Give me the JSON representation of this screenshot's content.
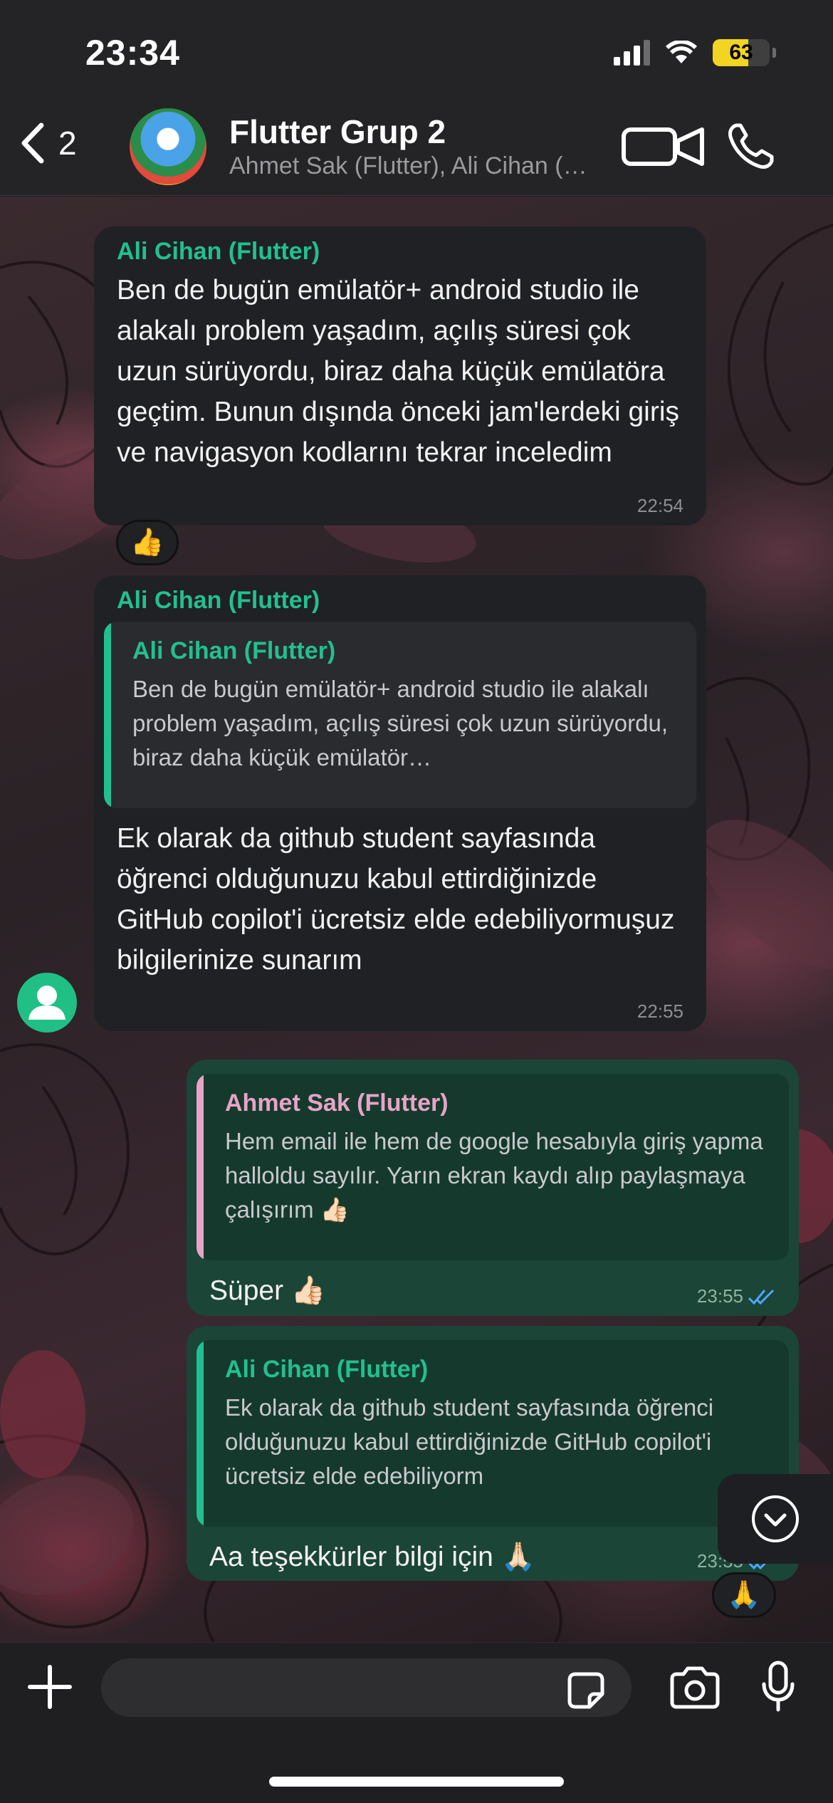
{
  "status_bar": {
    "time": "23:34",
    "battery": "63",
    "battery_level": 0.63
  },
  "header": {
    "back_count": "2",
    "title": "Flutter Grup 2",
    "subtitle": "Ahmet Sak (Flutter), Ali Cihan (Flutter)"
  },
  "messages": [
    {
      "sender": "Ali Cihan (Flutter)",
      "text": "Ben de bugün emülatör+ android studio ile alakalı problem yaşadım, açılış süresi çok uzun sürüyordu, biraz daha küçük emülatöra geçtim. Bunun dışında önceki jam'lerdeki giriş ve navigasyon kodlarını tekrar inceledim",
      "time": "22:54",
      "reaction": "👍"
    },
    {
      "sender": "Ali Cihan (Flutter)",
      "quote_name": "Ali Cihan (Flutter)",
      "quote_text": "Ben de bugün emülatör+ android studio ile alakalı problem yaşadım, açılış süresi çok uzun sürüyordu, biraz daha küçük emülatör…",
      "text": "Ek olarak da github student sayfasında öğrenci olduğunuzu kabul ettirdiğinizde GitHub copilot'i ücretsiz elde edebiliyormuşuz bilgilerinize sunarım",
      "time": "22:55"
    },
    {
      "quote_name": "Ahmet Sak (Flutter)",
      "quote_text": "Hem email ile hem de google hesabıyla giriş yapma halloldu sayılır. Yarın ekran kaydı alıp paylaşmaya çalışırım 👍🏻",
      "text": "Süper 👍🏻",
      "time": "23:55"
    },
    {
      "quote_name": "Ali Cihan (Flutter)",
      "quote_text": "Ek olarak da github student sayfasında öğrenci olduğunuzu kabul ettirdiğinizde GitHub copilot'i ücretsiz elde edebiliyorm",
      "text": "Aa teşekkürler bilgi için 🙏🏻",
      "time": "23:55",
      "reaction": "🙏"
    }
  ],
  "composer": {
    "placeholder": ""
  },
  "icons": [
    "back-chevron-icon",
    "video-call-icon",
    "phone-icon",
    "plus-icon",
    "sticker-icon",
    "camera-icon",
    "microphone-icon",
    "chevron-down-icon",
    "read-receipt-icon"
  ]
}
